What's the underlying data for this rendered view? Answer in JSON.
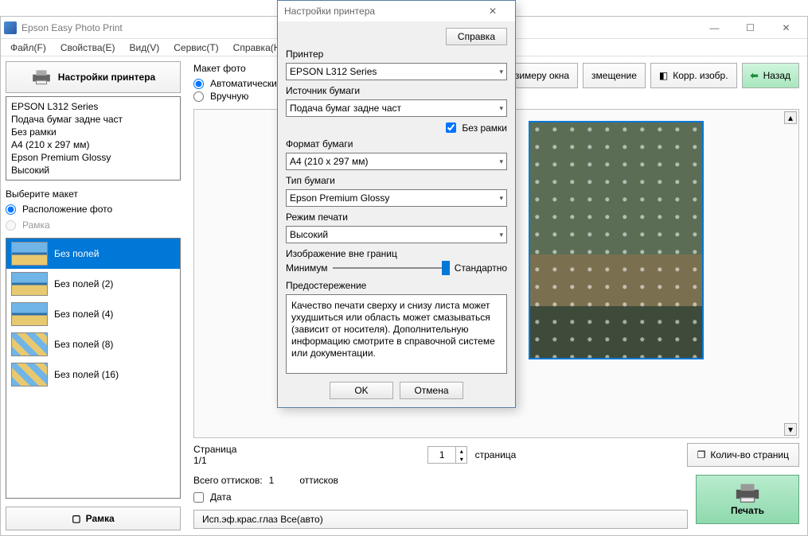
{
  "main": {
    "title": "Epson Easy Photo Print",
    "menu": [
      "Файл(F)",
      "Свойства(E)",
      "Вид(V)",
      "Сервис(T)",
      "Справка(H)"
    ]
  },
  "left": {
    "printer_settings_btn": "Настройки принтера",
    "info": [
      "EPSON L312 Series",
      "Подача бумаг задне част",
      "Без рамки",
      "A4 (210 x 297 мм)",
      "Epson Premium Glossy",
      "Высокий"
    ],
    "select_layout_label": "Выберите макет",
    "radio_layout_photo": "Расположение фото",
    "radio_frame": "Рамка",
    "layouts": [
      {
        "label": "Без полей",
        "selected": true
      },
      {
        "label": "Без полей (2)"
      },
      {
        "label": "Без полей (4)"
      },
      {
        "label": "Без полей (8)"
      },
      {
        "label": "Без полей (16)"
      }
    ],
    "frame_btn": "Рамка"
  },
  "right": {
    "group_title": "Макет фото",
    "radio_auto": "Автоматически",
    "radio_manual": "Вручную",
    "fit_window": "зимеру окна",
    "fit_btn": "змещение",
    "corr_btn": "Корр. изобр.",
    "back_btn": "Назад",
    "page_label": "Страница",
    "page_value": "1/1",
    "spinner_value": "1",
    "page_unit": "страница",
    "pages_count_btn": "Колич-во страниц",
    "total_label": "Всего оттисков:",
    "total_value": "1",
    "copies_unit": "оттисков",
    "date_chk": "Дата",
    "redeye_btn": "Исп.эф.крас.глаз Все(авто)",
    "print_btn": "Печать"
  },
  "dialog": {
    "title": "Настройки принтера",
    "help_btn": "Справка",
    "printer_label": "Принтер",
    "printer_value": "EPSON L312 Series",
    "source_label": "Источник бумаги",
    "source_value": "Подача бумаг задне част",
    "borderless_chk": "Без рамки",
    "format_label": "Формат бумаги",
    "format_value": "A4 (210 x 297 мм)",
    "type_label": "Тип бумаги",
    "type_value": "Epson Premium Glossy",
    "mode_label": "Режим печати",
    "mode_value": "Высокий",
    "overflow_label": "Изображение вне границ",
    "slider_min": "Минимум",
    "slider_max": "Стандартно",
    "warning_label": "Предостережение",
    "warning_text": "Качество печати сверху и снизу листа может ухудшиться или область может смазываться (зависит от носителя). Дополнительную информацию смотрите в справочной системе или документации.",
    "ok_btn": "OK",
    "cancel_btn": "Отмена"
  }
}
